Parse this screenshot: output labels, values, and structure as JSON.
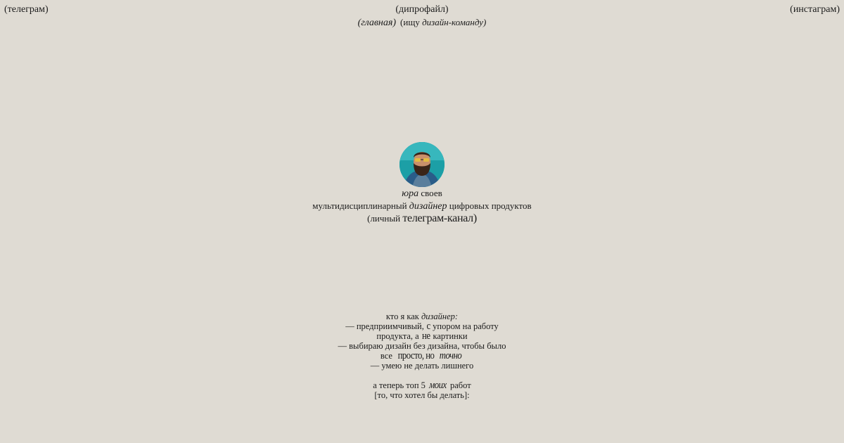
{
  "corners": {
    "left": "(телеграм)",
    "right": "(инстаграм)"
  },
  "header": {
    "title": "(дипрофайл)",
    "nav": {
      "main": "(главная)",
      "hire_open": "(ищу ",
      "hire_it": "дизайн-команду)"
    }
  },
  "profile": {
    "name_first": "юра",
    "name_last": " своев",
    "role_a": "мультидисциплинарный ",
    "role_b": "дизайнер",
    "role_c": " цифровых продуктов",
    "channel_a": "(личный ",
    "channel_b": "телеграм-канал)"
  },
  "about": {
    "l1_a": "кто я как ",
    "l1_b": "дизайнер:",
    "l2_a": "— предприимчивый, ",
    "l2_b": "с",
    "l2_c": " упором на работу",
    "l3_a": "продукта, а ",
    "l3_b": "не",
    "l3_c": " картинки",
    "l4": "— выбираю дизайн без дизайна, чтобы было",
    "l5_a": "все ",
    "l5_b": "просто, но ",
    "l5_c": "точно",
    "l6": "— умею не делать лишнего",
    "l7_a": "а теперь топ 5 ",
    "l7_b": "моих",
    "l7_c": " работ",
    "l8": "[то, что хотел бы делать]:"
  },
  "colors": {
    "background": "#dfdbd3",
    "text": "#1b1b1b",
    "avatar_bg": "#1ea3a8"
  },
  "icons": {
    "avatar": "user-photo-avatar"
  }
}
